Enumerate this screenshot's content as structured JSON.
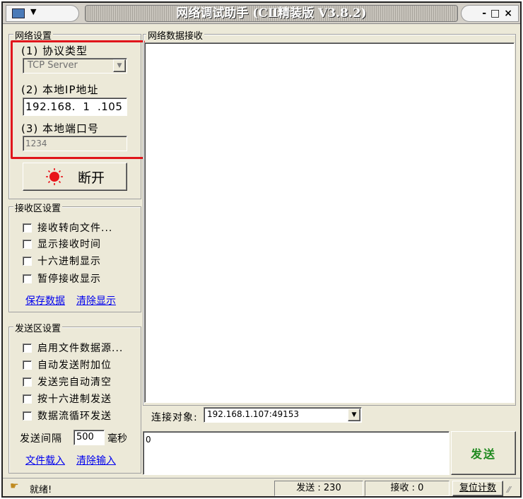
{
  "window": {
    "title": "网络调试助手 (CⅡ精装版 V3.8.2)",
    "controls": {
      "minimize": "-",
      "maximize": "□",
      "close": "×"
    }
  },
  "network_settings": {
    "group_label": "网络设置",
    "protocol_label": "(1) 协议类型",
    "protocol_value": "TCP Server",
    "ip_label": "(2) 本地IP地址",
    "ip_parts": [
      "192",
      "168",
      "1",
      "105"
    ],
    "port_label": "(3) 本地端口号",
    "port_value": "1234",
    "disconnect_label": "断开",
    "highlight_color": "#e0151b"
  },
  "receive_settings": {
    "group_label": "接收区设置",
    "options": [
      "接收转向文件...",
      "显示接收时间",
      "十六进制显示",
      "暂停接收显示"
    ],
    "save_link": "保存数据",
    "clear_link": "清除显示"
  },
  "send_settings": {
    "group_label": "发送区设置",
    "options": [
      "启用文件数据源...",
      "自动发送附加位",
      "发送完自动清空",
      "按十六进制发送",
      "数据流循环发送"
    ],
    "interval_label": "发送间隔",
    "interval_value": "500",
    "interval_unit": "毫秒",
    "load_link": "文件载入",
    "clear_input_link": "清除输入"
  },
  "receive_area": {
    "group_label": "网络数据接收",
    "content": ""
  },
  "connection": {
    "label": "连接对象:",
    "selected": "192.168.1.107:49153"
  },
  "send_area": {
    "content": "0",
    "send_button": "发送",
    "send_button_color": "#1f8a1f"
  },
  "status_bar": {
    "status_text": "就绪!",
    "send_count_label": "发送 : 230",
    "recv_count_label": "接收 : 0",
    "reset_label": "复位计数"
  }
}
